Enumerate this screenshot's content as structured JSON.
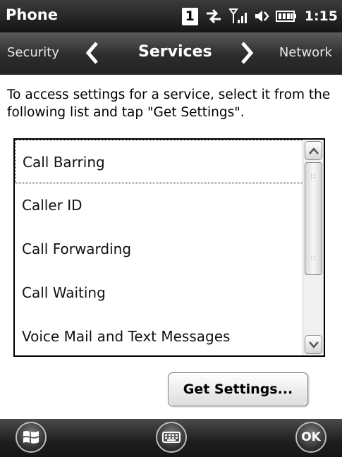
{
  "status_bar": {
    "app_title": "Phone",
    "sim_slot": "1",
    "time": "1:15",
    "icons": [
      "sim-slot-icon",
      "data-connection-icon",
      "signal-strength-icon",
      "speaker-volume-icon",
      "battery-icon"
    ]
  },
  "tab_bar": {
    "previous": "Security",
    "current": "Services",
    "next": "Network"
  },
  "instructions": "To access settings for a service, select it from the following list and tap \"Get Settings\".",
  "services_list": {
    "items": [
      {
        "label": "Call Barring"
      },
      {
        "label": "Caller ID"
      },
      {
        "label": "Call Forwarding"
      },
      {
        "label": "Call Waiting"
      },
      {
        "label": "Voice Mail and Text Messages"
      }
    ],
    "selected_index": 0
  },
  "buttons": {
    "get_settings": "Get Settings..."
  },
  "bottom_bar": {
    "ok_label": "OK",
    "icons": [
      "windows-start-icon",
      "keyboard-icon"
    ]
  },
  "colors": {
    "bar_dark": "#1e1e1e",
    "text": "#000000",
    "background": "#ffffff"
  }
}
